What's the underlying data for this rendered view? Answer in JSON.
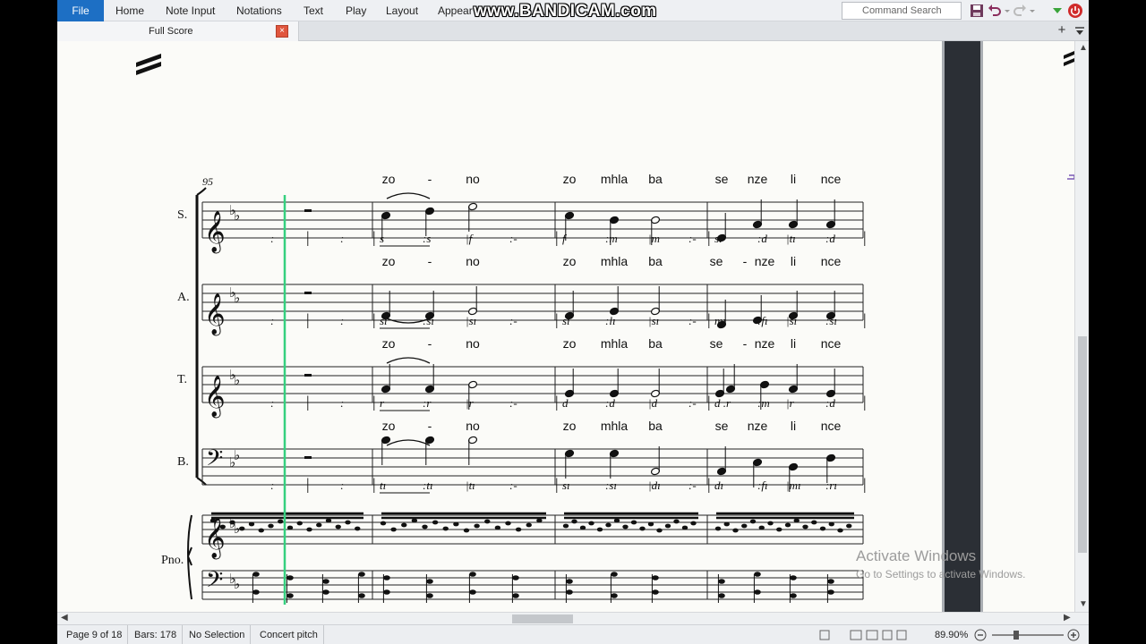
{
  "ribbon": {
    "file": "File",
    "tabs": [
      "Home",
      "Note Input",
      "Notations",
      "Text",
      "Play",
      "Layout",
      "Appear"
    ],
    "watermark": "www.BANDICAM.com",
    "search_placeholder": "Command Search"
  },
  "document_tab": {
    "label": "Full Score",
    "close": "×",
    "add": "+"
  },
  "score": {
    "bar_number": "95",
    "staves": [
      {
        "name": "S.",
        "lyrics": [
          "zo",
          "-",
          "no",
          "zo",
          "mhla",
          "ba",
          "se",
          "nze",
          "li",
          "nce"
        ],
        "solfa": [
          ":",
          "|",
          ":",
          "|",
          "s",
          ":s",
          "|f",
          ":-",
          "|",
          "f",
          ":m",
          "|m",
          ":-",
          "|",
          "sı",
          ":d",
          "|tı",
          ":d",
          "|"
        ]
      },
      {
        "name": "A.",
        "lyrics": [
          "zo",
          "-",
          "no",
          "zo",
          "mhla",
          "ba",
          "se",
          "-",
          "nze",
          "li",
          "nce"
        ],
        "solfa": [
          ":",
          "|",
          ":",
          "|",
          "sı",
          ":sı",
          "|sı",
          ":-",
          "|",
          "sı",
          ":lı",
          "|sı",
          ":-",
          "|",
          "mı",
          ":fı",
          "|sı",
          ":sı",
          "|"
        ]
      },
      {
        "name": "T.",
        "lyrics": [
          "zo",
          "-",
          "no",
          "zo",
          "mhla",
          "ba",
          "se",
          "-",
          "nze",
          "li",
          "nce"
        ],
        "solfa": [
          ":",
          "|",
          ":",
          "|",
          "r",
          ":r",
          "|r",
          ":-",
          "|",
          "d",
          ":d",
          "|d",
          ":-",
          "|",
          "d .r",
          ":m",
          "|r",
          ":d",
          "|"
        ]
      },
      {
        "name": "B.",
        "lyrics": [
          "zo",
          "-",
          "no",
          "zo",
          "mhla",
          "ba",
          "se",
          "nze",
          "li",
          "nce"
        ],
        "solfa": [
          ":",
          "|",
          ":",
          "|",
          "tı",
          ":tı",
          "|tı",
          ":-",
          "|",
          "sı",
          ":sı",
          "|dı",
          ":-",
          "|",
          "dı",
          ":fı",
          "|mı",
          ":rı",
          "|"
        ]
      }
    ],
    "piano": "Pno."
  },
  "watermark_windows": {
    "title": "Activate Windows",
    "subtitle": "Go to Settings to activate Windows."
  },
  "status": {
    "page": "Page 9 of 18",
    "bars": "Bars: 178",
    "selection": "No Selection",
    "pitch": "Concert pitch",
    "zoom": "89.90%"
  }
}
